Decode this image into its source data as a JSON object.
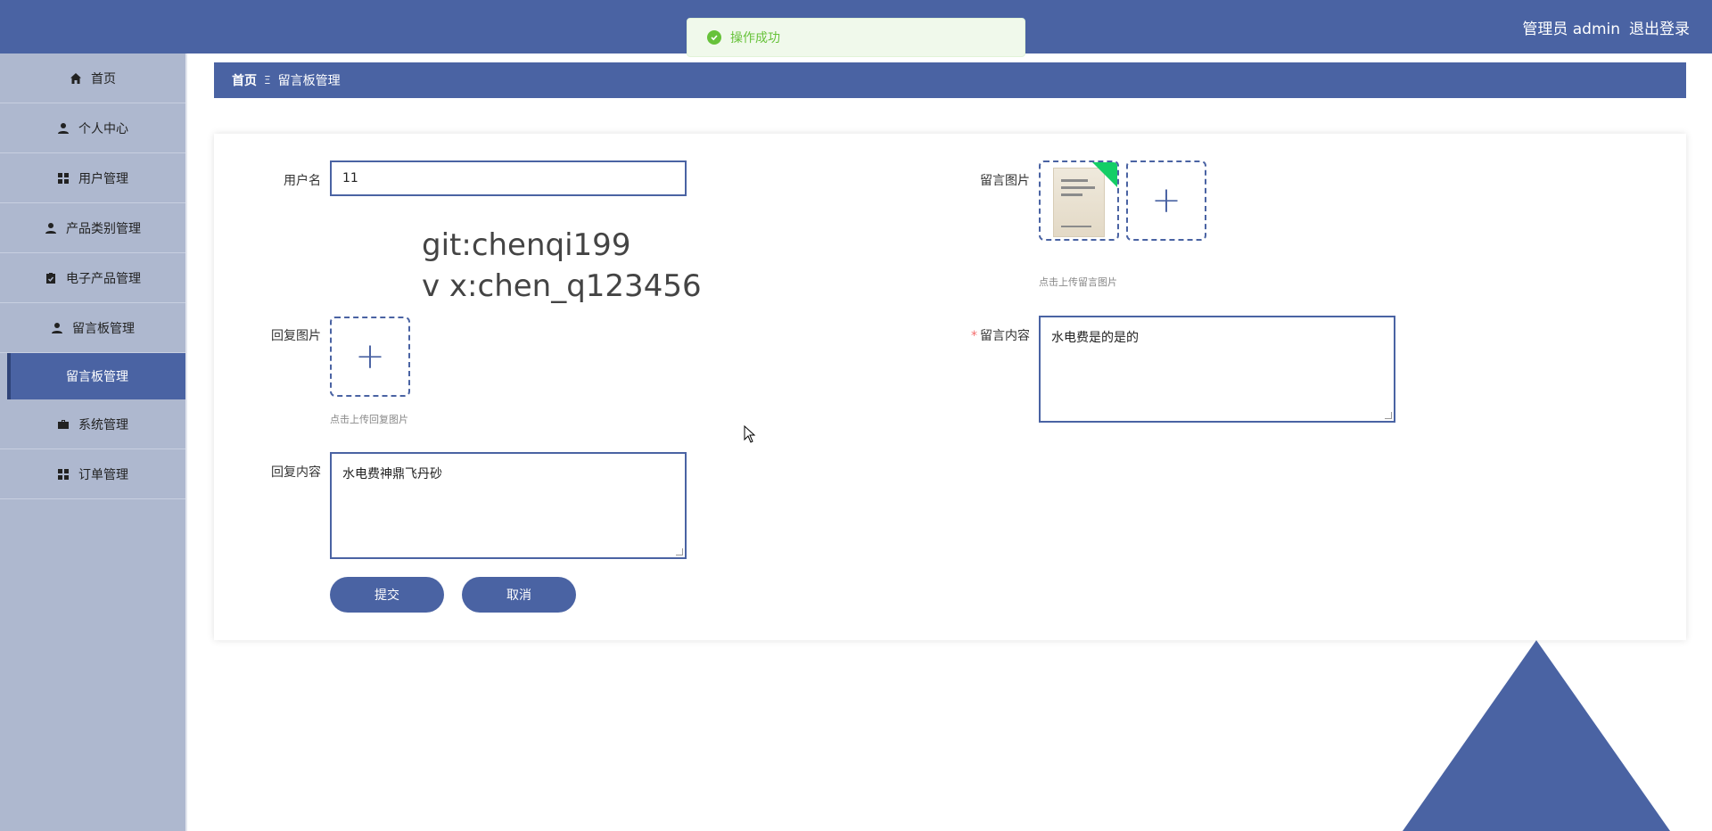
{
  "header": {
    "admin_label": "管理员 admin",
    "logout_label": "退出登录"
  },
  "toast": {
    "message": "操作成功"
  },
  "sidebar": {
    "items": [
      {
        "label": "首页",
        "icon": "home-icon"
      },
      {
        "label": "个人中心",
        "icon": "user-icon"
      },
      {
        "label": "用户管理",
        "icon": "grid-icon"
      },
      {
        "label": "产品类别管理",
        "icon": "user-icon"
      },
      {
        "label": "电子产品管理",
        "icon": "clipboard-icon"
      },
      {
        "label": "留言板管理",
        "icon": "person-icon"
      }
    ],
    "sub_item": {
      "label": "留言板管理"
    },
    "items_after": [
      {
        "label": "系统管理",
        "icon": "briefcase-icon"
      },
      {
        "label": "订单管理",
        "icon": "grid-icon"
      }
    ]
  },
  "breadcrumb": {
    "home": "首页",
    "separator": "Ξ",
    "current": "留言板管理"
  },
  "form": {
    "username_label": "用户名",
    "username_value": "11",
    "reply_image_label": "回复图片",
    "reply_image_hint": "点击上传回复图片",
    "reply_content_label": "回复内容",
    "reply_content_value": "水电费神鼎飞丹砂",
    "message_image_label": "留言图片",
    "message_image_hint": "点击上传留言图片",
    "message_content_label": "留言内容",
    "message_content_value": "水电费是的是的",
    "submit_label": "提交",
    "cancel_label": "取消"
  },
  "watermark": {
    "line1": "git:chenqi199",
    "line2": "v x:chen_q123456"
  }
}
